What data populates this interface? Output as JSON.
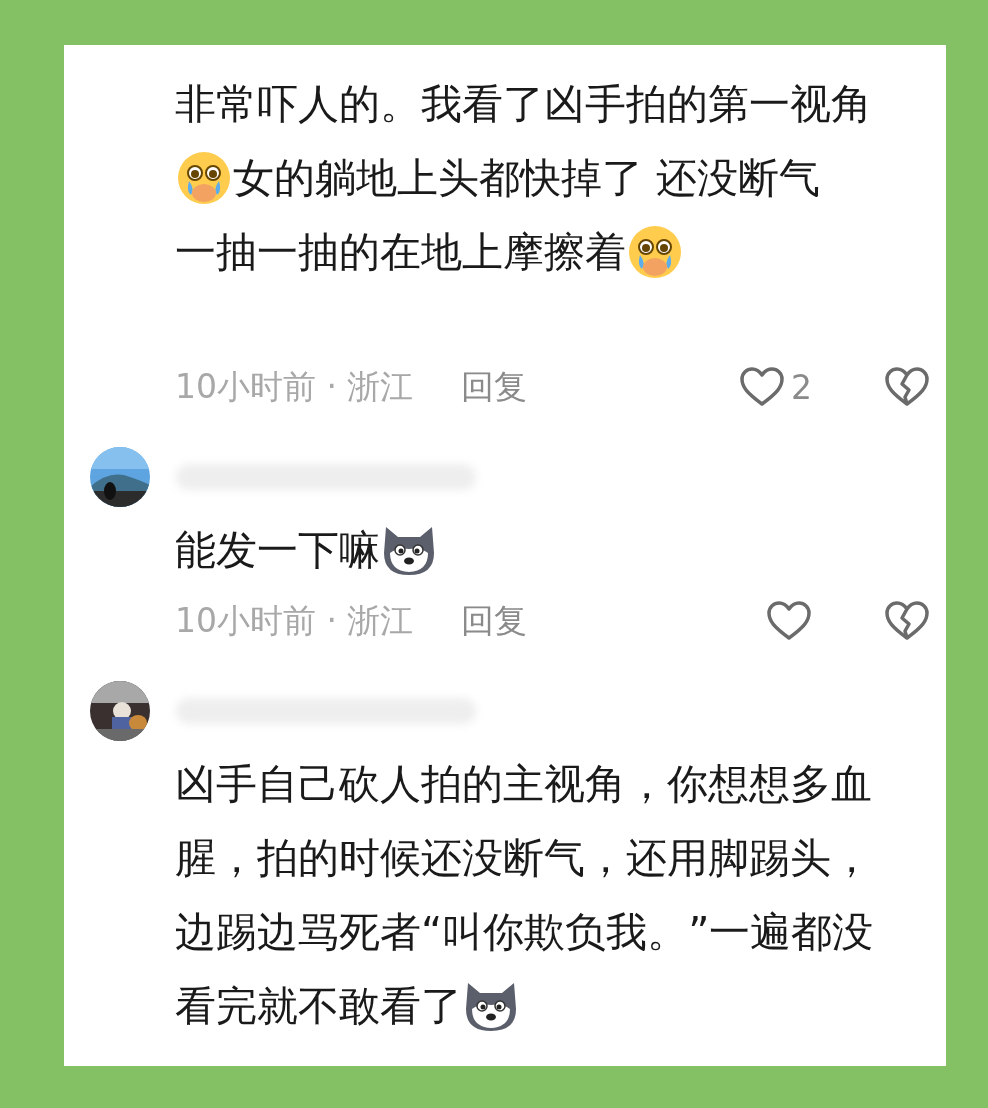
{
  "comments": [
    {
      "avatar": false,
      "lines": [
        [
          {
            "kind": "text",
            "text": "非常吓人的。我看了凶手拍的第一视角"
          }
        ],
        [
          {
            "kind": "sob"
          },
          {
            "kind": "text",
            "text": " 女的躺地上头都快掉了 还没断气"
          }
        ],
        [
          {
            "kind": "text",
            "text": "一抽一抽的在地上摩擦着"
          },
          {
            "kind": "sob"
          }
        ]
      ],
      "time": "10小时前 · 浙江",
      "reply": "回复",
      "likes": "2"
    },
    {
      "avatar": true,
      "lines": [
        [
          {
            "kind": "text",
            "text": "能发一下嘛"
          },
          {
            "kind": "dog"
          }
        ]
      ],
      "time": "10小时前 · 浙江",
      "reply": "回复"
    },
    {
      "avatar": true,
      "lines": [
        [
          {
            "kind": "text",
            "text": "凶手自己砍人拍的主视角，你想想多血"
          }
        ],
        [
          {
            "kind": "text",
            "text": "腥，拍的时候还没断气，还用脚踢头，"
          }
        ],
        [
          {
            "kind": "text",
            "text": "边踢边骂死者“叫你欺负我。”一遍都没"
          }
        ],
        [
          {
            "kind": "text",
            "text": "看完就不敢看了"
          },
          {
            "kind": "dog"
          }
        ]
      ]
    }
  ]
}
